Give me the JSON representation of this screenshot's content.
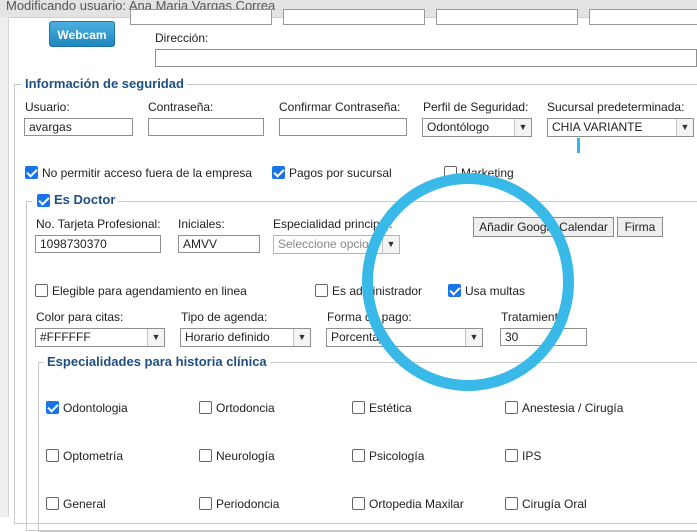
{
  "window": {
    "title": "Modificando usuario: Ana Maria Vargas Correa"
  },
  "top": {
    "webcam_label": "Webcam",
    "direccion_label": "Dirección:",
    "direccion_value": ""
  },
  "seguridad": {
    "legend": "Información de seguridad",
    "usuario_label": "Usuario:",
    "usuario_value": "avargas",
    "contrasena_label": "Contraseña:",
    "contrasena_value": "",
    "confirmar_label": "Confirmar Contraseña:",
    "confirmar_value": "",
    "perfil_label": "Perfil de Seguridad:",
    "perfil_value": "Odontólogo",
    "sucursal_label": "Sucursal predeterminada:",
    "sucursal_value": "CHIA VARIANTE",
    "no_permitir_label": "No permitir acceso fuera de la empresa",
    "no_permitir_checked": true,
    "pagos_sucursal_label": "Pagos por sucursal",
    "pagos_sucursal_checked": true,
    "marketing_label": "Marketing",
    "marketing_checked": false
  },
  "doctor": {
    "legend": "Es Doctor",
    "es_doctor_checked": true,
    "tarjeta_label": "No. Tarjeta Profesional:",
    "tarjeta_value": "1098730370",
    "iniciales_label": "Iniciales:",
    "iniciales_value": "AMVV",
    "especialidad_label": "Especialidad principal:",
    "especialidad_placeholder": "Seleccione opcion",
    "google_calendar_label": "Añadir Google Calendar",
    "firma_label": "Firma",
    "elegible_label": "Elegible para agendamiento en linea",
    "elegible_checked": false,
    "admin_label": "Es administrador",
    "admin_checked": false,
    "multas_label": "Usa multas",
    "multas_checked": true,
    "color_label": "Color para citas:",
    "color_value": "#FFFFFF",
    "tipo_agenda_label": "Tipo de agenda:",
    "tipo_agenda_value": "Horario definido",
    "forma_pago_label": "Forma de pago:",
    "forma_pago_value": "Porcentaje",
    "tratamiento_label": "Tratamiento:",
    "tratamiento_value": "30"
  },
  "especialidades": {
    "legend": "Especialidades para historia clínica",
    "items": [
      {
        "label": "Odontologia",
        "checked": true
      },
      {
        "label": "Ortodoncia",
        "checked": false
      },
      {
        "label": "Estética",
        "checked": false
      },
      {
        "label": "Anestesia / Cirugía",
        "checked": false
      },
      {
        "label": "Optometría",
        "checked": false
      },
      {
        "label": "Neurología",
        "checked": false
      },
      {
        "label": "Psicología",
        "checked": false
      },
      {
        "label": "IPS",
        "checked": false
      },
      {
        "label": "General",
        "checked": false
      },
      {
        "label": "Periodoncia",
        "checked": false
      },
      {
        "label": "Ortopedia Maxilar",
        "checked": false
      },
      {
        "label": "Cirugía Oral",
        "checked": false
      }
    ]
  },
  "colors": {
    "accent": "#1a73e8",
    "legend": "#1f4f82",
    "annotation_circle": "#38b9e8",
    "webcam_button": "#2a96cf"
  },
  "icons": {
    "checkbox": "checkbox-icon",
    "dropdown": "chevron-down-icon"
  }
}
